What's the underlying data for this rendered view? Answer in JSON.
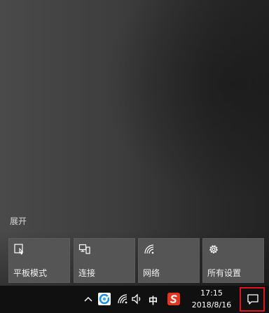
{
  "action_center": {
    "expand_label": "展开",
    "quick_actions": [
      {
        "label": "平板模式",
        "icon": "tablet-mode-icon"
      },
      {
        "label": "连接",
        "icon": "connect-icon"
      },
      {
        "label": "网络",
        "icon": "network-icon"
      },
      {
        "label": "所有设置",
        "icon": "gear-icon"
      }
    ]
  },
  "taskbar": {
    "ime_label": "中",
    "time": "17:15",
    "date": "2018/8/16",
    "icons": [
      "chevron-up-icon",
      "browser-icon",
      "wifi-icon",
      "volume-icon",
      "sogou-ime-icon",
      "notification-icon"
    ],
    "highlight_color": "#e0141e"
  }
}
